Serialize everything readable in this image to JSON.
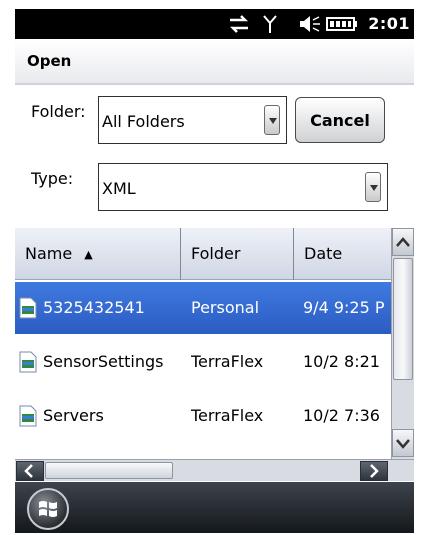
{
  "status_bar": {
    "time": "2:01",
    "icons": [
      "sync-arrows-icon",
      "signal-antenna-icon",
      "speaker-icon",
      "battery-icon"
    ]
  },
  "dialog": {
    "title": "Open"
  },
  "folder": {
    "label": "Folder:",
    "value": "All Folders"
  },
  "type": {
    "label": "Type:",
    "value": "XML"
  },
  "buttons": {
    "cancel": "Cancel"
  },
  "list": {
    "columns": [
      {
        "label": "Name",
        "sort": "▲"
      },
      {
        "label": "Folder"
      },
      {
        "label": "Date"
      }
    ],
    "rows": [
      {
        "name": "5325432541",
        "folder": "Personal",
        "date": "9/4 9:25 P",
        "selected": true
      },
      {
        "name": "SensorSettings",
        "folder": "TerraFlex",
        "date": "10/2 8:21",
        "selected": false
      },
      {
        "name": "Servers",
        "folder": "TerraFlex",
        "date": "10/2 7:36",
        "selected": false
      }
    ]
  },
  "colors": {
    "selection": "#2f63cc",
    "header": "#d9dfea",
    "taskbar": "#22272c"
  }
}
